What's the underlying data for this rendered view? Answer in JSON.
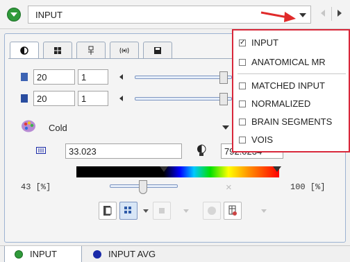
{
  "selector": {
    "value": "INPUT"
  },
  "tabs": [
    {
      "icon": "contrast-icon"
    },
    {
      "icon": "grid-icon"
    },
    {
      "icon": "tool-icon"
    },
    {
      "icon": "wave-icon"
    },
    {
      "icon": "save-icon"
    }
  ],
  "slice_rows": [
    {
      "a": "20",
      "b": "1"
    },
    {
      "a": "20",
      "b": "1"
    }
  ],
  "colormap": {
    "label": "Cold"
  },
  "range": {
    "lower": "33.023",
    "upper": "792.0234"
  },
  "threshold": {
    "lower_label": "43 [%]",
    "upper_label": "100 [%]",
    "clear_symbol": "×"
  },
  "dropdown": {
    "items": [
      {
        "label": "INPUT",
        "checked": true
      },
      {
        "label": "ANATOMICAL MR",
        "checked": false
      },
      {
        "label": "MATCHED INPUT",
        "checked": false
      },
      {
        "label": "NORMALIZED",
        "checked": false
      },
      {
        "label": "BRAIN SEGMENTS",
        "checked": false
      },
      {
        "label": "VOIS",
        "checked": false
      }
    ]
  },
  "bottom_tabs": [
    {
      "label": "INPUT",
      "color": "#2f9a3a"
    },
    {
      "label": "INPUT AVG",
      "color": "#1a2aa8"
    }
  ],
  "colors": {
    "accent": "#d8273a",
    "panel_border": "#9cb3d2"
  }
}
